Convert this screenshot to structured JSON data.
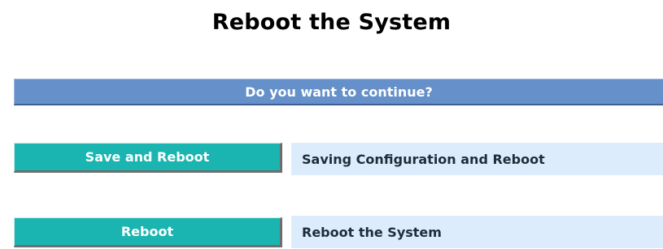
{
  "page": {
    "title": "Reboot the System"
  },
  "confirm": {
    "prompt": "Do you want to continue?"
  },
  "actions": [
    {
      "button_label": "Save and Reboot",
      "description": "Saving Configuration and Reboot"
    },
    {
      "button_label": "Reboot",
      "description": "Reboot the System"
    }
  ],
  "colors": {
    "header_bar": "#6690c9",
    "button": "#1ab5b0",
    "description_bg": "#ddecfc"
  }
}
